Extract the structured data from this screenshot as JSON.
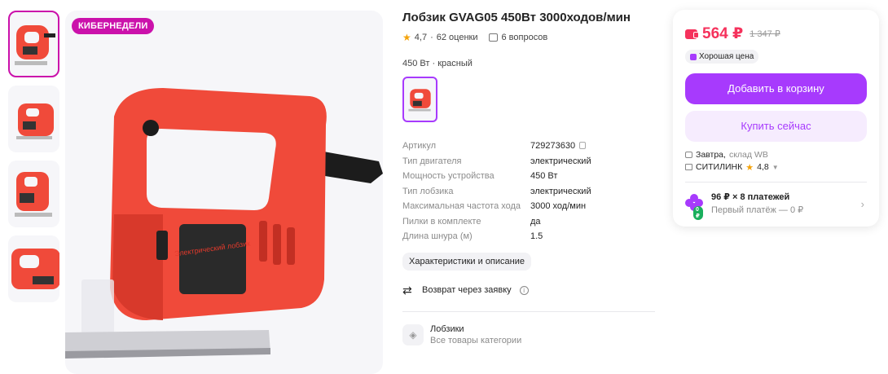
{
  "gallery": {
    "badge": "КИБЕРНЕДЕЛИ",
    "thumbnails": [
      "thumb-1",
      "thumb-2",
      "thumb-3",
      "thumb-4"
    ]
  },
  "product": {
    "title": "Лобзик GVAG05 450Вт 3000ходов/мин",
    "rating": "4,7",
    "reviews": "62 оценки",
    "questions": "6 вопросов",
    "variant": "450 Вт · красный",
    "image_label": "Электрический лобзик",
    "specs": [
      {
        "key": "Артикул",
        "value": "729273630"
      },
      {
        "key": "Тип двигателя",
        "value": "электрический"
      },
      {
        "key": "Мощность устройства",
        "value": "450 Вт"
      },
      {
        "key": "Тип лобзика",
        "value": "электрический"
      },
      {
        "key": "Максимальная частота хода",
        "value": "3000 ход/мин"
      },
      {
        "key": "Пилки в комплекте",
        "value": "да"
      },
      {
        "key": "Длина шнура (м)",
        "value": "1.5"
      }
    ],
    "specs_button": "Характеристики и описание",
    "return_text": "Возврат через заявку",
    "category_name": "Лобзики",
    "category_link": "Все товары категории"
  },
  "buy_card": {
    "price": "564 ₽",
    "old_price": "1 347 ₽",
    "good_price": "Хорошая цена",
    "add_to_cart": "Добавить в корзину",
    "buy_now": "Купить сейчас",
    "delivery_day": "Завтра,",
    "delivery_from": "склад WB",
    "seller_name": "СИТИЛИНК",
    "seller_rating": "4,8",
    "installment_main": "96 ₽ × 8 платежей",
    "installment_sub": "Первый платёж — 0 ₽",
    "installment_badge": "0 ₽"
  },
  "colors": {
    "accent": "#a73afd",
    "badge": "#cb11ab",
    "price": "#f5325c",
    "tool_body": "#f04a3a"
  }
}
